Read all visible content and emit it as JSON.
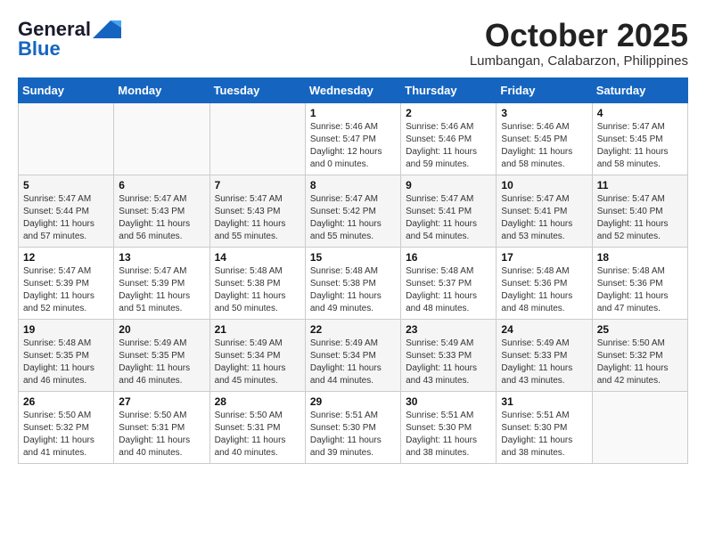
{
  "header": {
    "logo_general": "General",
    "logo_blue": "Blue",
    "month": "October 2025",
    "location": "Lumbangan, Calabarzon, Philippines"
  },
  "weekdays": [
    "Sunday",
    "Monday",
    "Tuesday",
    "Wednesday",
    "Thursday",
    "Friday",
    "Saturday"
  ],
  "weeks": [
    [
      {
        "day": "",
        "info": ""
      },
      {
        "day": "",
        "info": ""
      },
      {
        "day": "",
        "info": ""
      },
      {
        "day": "1",
        "info": "Sunrise: 5:46 AM\nSunset: 5:47 PM\nDaylight: 12 hours\nand 0 minutes."
      },
      {
        "day": "2",
        "info": "Sunrise: 5:46 AM\nSunset: 5:46 PM\nDaylight: 11 hours\nand 59 minutes."
      },
      {
        "day": "3",
        "info": "Sunrise: 5:46 AM\nSunset: 5:45 PM\nDaylight: 11 hours\nand 58 minutes."
      },
      {
        "day": "4",
        "info": "Sunrise: 5:47 AM\nSunset: 5:45 PM\nDaylight: 11 hours\nand 58 minutes."
      }
    ],
    [
      {
        "day": "5",
        "info": "Sunrise: 5:47 AM\nSunset: 5:44 PM\nDaylight: 11 hours\nand 57 minutes."
      },
      {
        "day": "6",
        "info": "Sunrise: 5:47 AM\nSunset: 5:43 PM\nDaylight: 11 hours\nand 56 minutes."
      },
      {
        "day": "7",
        "info": "Sunrise: 5:47 AM\nSunset: 5:43 PM\nDaylight: 11 hours\nand 55 minutes."
      },
      {
        "day": "8",
        "info": "Sunrise: 5:47 AM\nSunset: 5:42 PM\nDaylight: 11 hours\nand 55 minutes."
      },
      {
        "day": "9",
        "info": "Sunrise: 5:47 AM\nSunset: 5:41 PM\nDaylight: 11 hours\nand 54 minutes."
      },
      {
        "day": "10",
        "info": "Sunrise: 5:47 AM\nSunset: 5:41 PM\nDaylight: 11 hours\nand 53 minutes."
      },
      {
        "day": "11",
        "info": "Sunrise: 5:47 AM\nSunset: 5:40 PM\nDaylight: 11 hours\nand 52 minutes."
      }
    ],
    [
      {
        "day": "12",
        "info": "Sunrise: 5:47 AM\nSunset: 5:39 PM\nDaylight: 11 hours\nand 52 minutes."
      },
      {
        "day": "13",
        "info": "Sunrise: 5:47 AM\nSunset: 5:39 PM\nDaylight: 11 hours\nand 51 minutes."
      },
      {
        "day": "14",
        "info": "Sunrise: 5:48 AM\nSunset: 5:38 PM\nDaylight: 11 hours\nand 50 minutes."
      },
      {
        "day": "15",
        "info": "Sunrise: 5:48 AM\nSunset: 5:38 PM\nDaylight: 11 hours\nand 49 minutes."
      },
      {
        "day": "16",
        "info": "Sunrise: 5:48 AM\nSunset: 5:37 PM\nDaylight: 11 hours\nand 48 minutes."
      },
      {
        "day": "17",
        "info": "Sunrise: 5:48 AM\nSunset: 5:36 PM\nDaylight: 11 hours\nand 48 minutes."
      },
      {
        "day": "18",
        "info": "Sunrise: 5:48 AM\nSunset: 5:36 PM\nDaylight: 11 hours\nand 47 minutes."
      }
    ],
    [
      {
        "day": "19",
        "info": "Sunrise: 5:48 AM\nSunset: 5:35 PM\nDaylight: 11 hours\nand 46 minutes."
      },
      {
        "day": "20",
        "info": "Sunrise: 5:49 AM\nSunset: 5:35 PM\nDaylight: 11 hours\nand 46 minutes."
      },
      {
        "day": "21",
        "info": "Sunrise: 5:49 AM\nSunset: 5:34 PM\nDaylight: 11 hours\nand 45 minutes."
      },
      {
        "day": "22",
        "info": "Sunrise: 5:49 AM\nSunset: 5:34 PM\nDaylight: 11 hours\nand 44 minutes."
      },
      {
        "day": "23",
        "info": "Sunrise: 5:49 AM\nSunset: 5:33 PM\nDaylight: 11 hours\nand 43 minutes."
      },
      {
        "day": "24",
        "info": "Sunrise: 5:49 AM\nSunset: 5:33 PM\nDaylight: 11 hours\nand 43 minutes."
      },
      {
        "day": "25",
        "info": "Sunrise: 5:50 AM\nSunset: 5:32 PM\nDaylight: 11 hours\nand 42 minutes."
      }
    ],
    [
      {
        "day": "26",
        "info": "Sunrise: 5:50 AM\nSunset: 5:32 PM\nDaylight: 11 hours\nand 41 minutes."
      },
      {
        "day": "27",
        "info": "Sunrise: 5:50 AM\nSunset: 5:31 PM\nDaylight: 11 hours\nand 40 minutes."
      },
      {
        "day": "28",
        "info": "Sunrise: 5:50 AM\nSunset: 5:31 PM\nDaylight: 11 hours\nand 40 minutes."
      },
      {
        "day": "29",
        "info": "Sunrise: 5:51 AM\nSunset: 5:30 PM\nDaylight: 11 hours\nand 39 minutes."
      },
      {
        "day": "30",
        "info": "Sunrise: 5:51 AM\nSunset: 5:30 PM\nDaylight: 11 hours\nand 38 minutes."
      },
      {
        "day": "31",
        "info": "Sunrise: 5:51 AM\nSunset: 5:30 PM\nDaylight: 11 hours\nand 38 minutes."
      },
      {
        "day": "",
        "info": ""
      }
    ]
  ]
}
